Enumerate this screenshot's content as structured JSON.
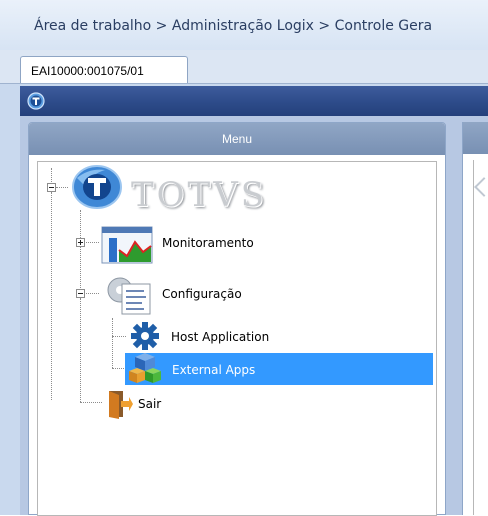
{
  "breadcrumb": {
    "text": "Área de trabalho > Administração Logix > Controle Gera"
  },
  "tabs": [
    {
      "label": "EAI10000:001075/01",
      "active": true
    }
  ],
  "menu_panel": {
    "title": "Menu"
  },
  "tree": {
    "root": {
      "logo_text": "TOTVS",
      "expanded": true
    },
    "items": [
      {
        "label": "Monitoramento",
        "icon": "chart-icon",
        "expanded": false
      },
      {
        "label": "Configuração",
        "icon": "settings-document-icon",
        "expanded": true
      },
      {
        "label": "Host Application",
        "icon": "gear-icon"
      },
      {
        "label": "External Apps",
        "icon": "cubes-icon",
        "selected": true
      },
      {
        "label": "Sair",
        "icon": "exit-door-icon"
      }
    ]
  },
  "colors": {
    "window_header": "#2c4a88",
    "menu_header": "#7890b3",
    "selection": "#3399ff",
    "breadcrumb_text": "#2a3e62"
  }
}
